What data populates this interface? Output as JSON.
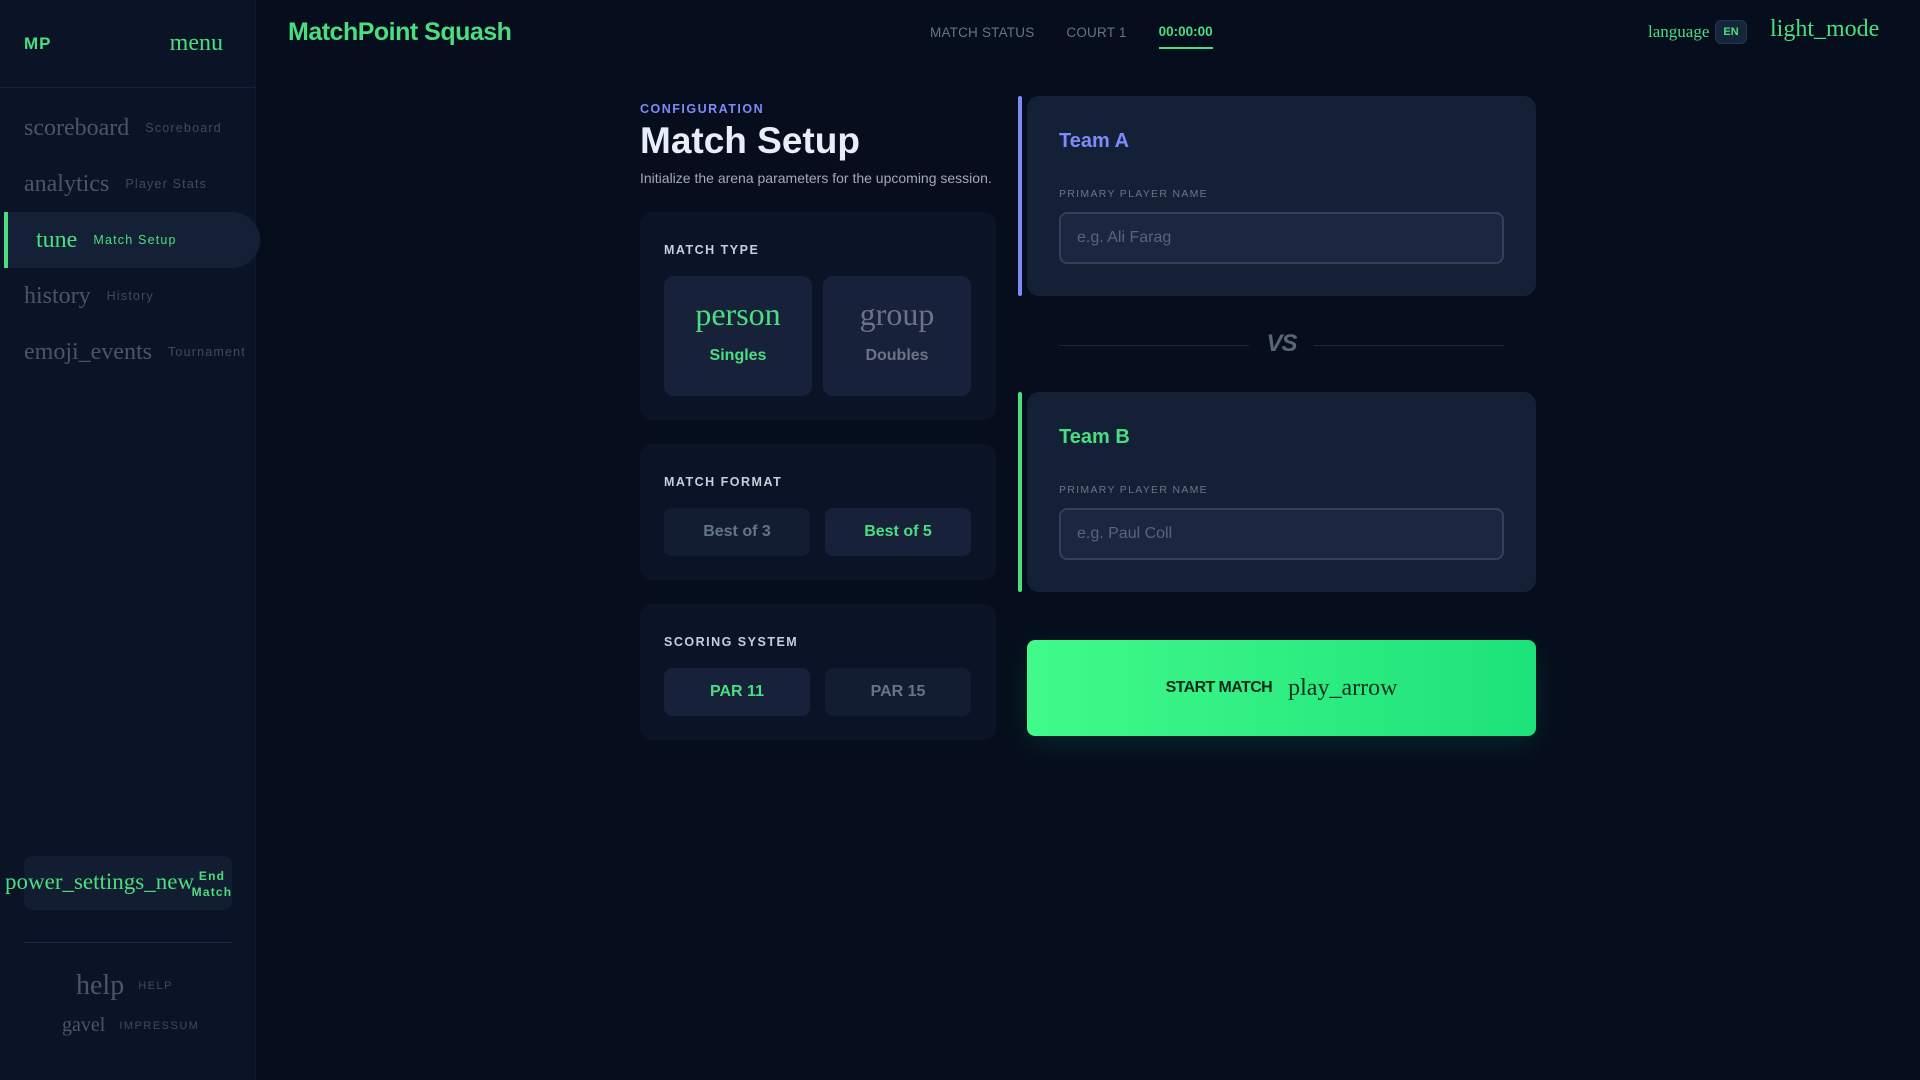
{
  "sidebar": {
    "logo": "MP",
    "menu_icon": "menu",
    "items": [
      {
        "icon": "scoreboard",
        "label": "Scoreboard",
        "active": false
      },
      {
        "icon": "analytics",
        "label": "Player Stats",
        "active": false
      },
      {
        "icon": "tune",
        "label": "Match Setup",
        "active": true
      },
      {
        "icon": "history",
        "label": "History",
        "active": false
      },
      {
        "icon": "emoji_events",
        "label": "Tournament",
        "active": false
      }
    ],
    "end_match": {
      "icon": "power_settings_new",
      "label": "End Match"
    },
    "footer": [
      {
        "icon": "help",
        "label": "HELP"
      },
      {
        "icon": "gavel",
        "label": "IMPRESSUM"
      }
    ]
  },
  "header": {
    "brand": "MatchPoint Squash",
    "nav": [
      "MATCH STATUS",
      "COURT 1"
    ],
    "timer": "00:00:00",
    "language_icon": "language",
    "language_code": "EN",
    "theme_icon": "light_mode"
  },
  "main": {
    "eyebrow": "CONFIGURATION",
    "title": "Match Setup",
    "subtitle": "Initialize the arena parameters for the upcoming session.",
    "match_type": {
      "label": "MATCH TYPE",
      "options": [
        {
          "icon": "person",
          "label": "Singles",
          "selected": true
        },
        {
          "icon": "group",
          "label": "Doubles",
          "selected": false
        }
      ]
    },
    "match_format": {
      "label": "MATCH FORMAT",
      "options": [
        {
          "label": "Best of 3",
          "selected": false
        },
        {
          "label": "Best of 5",
          "selected": true
        }
      ]
    },
    "scoring_system": {
      "label": "SCORING SYSTEM",
      "options": [
        {
          "label": "PAR 11",
          "selected": true
        },
        {
          "label": "PAR 15",
          "selected": false
        }
      ]
    },
    "team_a": {
      "name": "Team A",
      "field_label": "PRIMARY PLAYER NAME",
      "placeholder": "e.g. Ali Farag",
      "value": "",
      "accent": "#7c8cf8"
    },
    "vs": "VS",
    "team_b": {
      "name": "Team B",
      "field_label": "PRIMARY PLAYER NAME",
      "placeholder": "e.g. Paul Coll",
      "value": "",
      "accent": "#4ade80"
    },
    "start": {
      "label": "START MATCH",
      "icon": "play_arrow"
    }
  },
  "colors": {
    "accent_green": "#4ade80",
    "accent_indigo": "#7c8cf8",
    "background": "#060d1c"
  }
}
